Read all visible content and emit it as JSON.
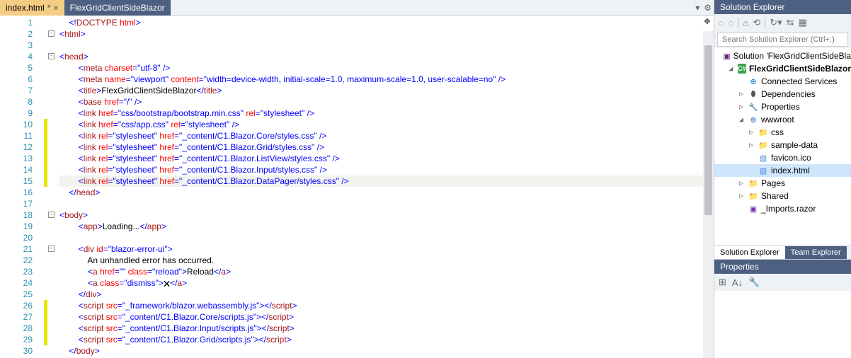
{
  "tabs": [
    {
      "label": "index.html",
      "dirty": "*",
      "active": true
    },
    {
      "label": "FlexGridClientSideBlazor",
      "dirty": "",
      "active": false
    }
  ],
  "code": {
    "lines": [
      {
        "n": 1,
        "ind": 1,
        "seg": [
          [
            "<!",
            "t-blue"
          ],
          [
            "DOCTYPE",
            "t-brown"
          ],
          [
            " ",
            "t-black"
          ],
          [
            "html",
            "t-red"
          ],
          [
            ">",
            "t-blue"
          ]
        ]
      },
      {
        "n": 2,
        "ind": 0,
        "box": "-",
        "seg": [
          [
            "<",
            "t-blue"
          ],
          [
            "html",
            "t-brown"
          ],
          [
            ">",
            "t-blue"
          ]
        ]
      },
      {
        "n": 3,
        "ind": 0,
        "seg": []
      },
      {
        "n": 4,
        "ind": 0,
        "box": "-",
        "seg": [
          [
            "<",
            "t-blue"
          ],
          [
            "head",
            "t-brown"
          ],
          [
            ">",
            "t-blue"
          ]
        ]
      },
      {
        "n": 5,
        "ind": 2,
        "seg": [
          [
            "<",
            "t-blue"
          ],
          [
            "meta",
            "t-brown"
          ],
          [
            " ",
            "t-black"
          ],
          [
            "charset",
            "t-red"
          ],
          [
            "=",
            "t-blue"
          ],
          [
            "\"utf-8\"",
            "t-blue"
          ],
          [
            " />",
            "t-blue"
          ]
        ]
      },
      {
        "n": 6,
        "ind": 2,
        "seg": [
          [
            "<",
            "t-blue"
          ],
          [
            "meta",
            "t-brown"
          ],
          [
            " ",
            "t-black"
          ],
          [
            "name",
            "t-red"
          ],
          [
            "=",
            "t-blue"
          ],
          [
            "\"viewport\"",
            "t-blue"
          ],
          [
            " ",
            "t-black"
          ],
          [
            "content",
            "t-red"
          ],
          [
            "=",
            "t-blue"
          ],
          [
            "\"width=device-width, initial-scale=1.0, maximum-scale=1.0, user-scalable=no\"",
            "t-blue"
          ],
          [
            " />",
            "t-blue"
          ]
        ]
      },
      {
        "n": 7,
        "ind": 2,
        "seg": [
          [
            "<",
            "t-blue"
          ],
          [
            "title",
            "t-brown"
          ],
          [
            ">",
            "t-blue"
          ],
          [
            "FlexGridClientSideBlazor",
            "t-black"
          ],
          [
            "</",
            "t-blue"
          ],
          [
            "title",
            "t-brown"
          ],
          [
            ">",
            "t-blue"
          ]
        ]
      },
      {
        "n": 8,
        "ind": 2,
        "seg": [
          [
            "<",
            "t-blue"
          ],
          [
            "base",
            "t-brown"
          ],
          [
            " ",
            "t-black"
          ],
          [
            "href",
            "t-red"
          ],
          [
            "=",
            "t-blue"
          ],
          [
            "\"/\"",
            "t-blue"
          ],
          [
            " />",
            "t-blue"
          ]
        ]
      },
      {
        "n": 9,
        "ind": 2,
        "seg": [
          [
            "<",
            "t-blue"
          ],
          [
            "link",
            "t-brown"
          ],
          [
            " ",
            "t-black"
          ],
          [
            "href",
            "t-red"
          ],
          [
            "=",
            "t-blue"
          ],
          [
            "\"css/bootstrap/bootstrap.min.css\"",
            "t-blue"
          ],
          [
            " ",
            "t-black"
          ],
          [
            "rel",
            "t-red"
          ],
          [
            "=",
            "t-blue"
          ],
          [
            "\"stylesheet\"",
            "t-blue"
          ],
          [
            " />",
            "t-blue"
          ]
        ]
      },
      {
        "n": 10,
        "ind": 2,
        "mark": true,
        "seg": [
          [
            "<",
            "t-blue"
          ],
          [
            "link",
            "t-brown"
          ],
          [
            " ",
            "t-black"
          ],
          [
            "href",
            "t-red"
          ],
          [
            "=",
            "t-blue"
          ],
          [
            "\"css/app.css\"",
            "t-blue"
          ],
          [
            " ",
            "t-black"
          ],
          [
            "rel",
            "t-red"
          ],
          [
            "=",
            "t-blue"
          ],
          [
            "\"stylesheet\"",
            "t-blue"
          ],
          [
            " />",
            "t-blue"
          ]
        ]
      },
      {
        "n": 11,
        "ind": 2,
        "mark": true,
        "seg": [
          [
            "<",
            "t-blue"
          ],
          [
            "link",
            "t-brown"
          ],
          [
            " ",
            "t-black"
          ],
          [
            "rel",
            "t-red"
          ],
          [
            "=",
            "t-blue"
          ],
          [
            "\"stylesheet\"",
            "t-blue"
          ],
          [
            " ",
            "t-black"
          ],
          [
            "href",
            "t-red"
          ],
          [
            "=",
            "t-blue"
          ],
          [
            "\"_content/C1.Blazor.Core/styles.css\"",
            "t-blue"
          ],
          [
            " />",
            "t-blue"
          ]
        ]
      },
      {
        "n": 12,
        "ind": 2,
        "mark": true,
        "seg": [
          [
            "<",
            "t-blue"
          ],
          [
            "link",
            "t-brown"
          ],
          [
            " ",
            "t-black"
          ],
          [
            "rel",
            "t-red"
          ],
          [
            "=",
            "t-blue"
          ],
          [
            "\"stylesheet\"",
            "t-blue"
          ],
          [
            " ",
            "t-black"
          ],
          [
            "href",
            "t-red"
          ],
          [
            "=",
            "t-blue"
          ],
          [
            "\"_content/C1.Blazor.Grid/styles.css\"",
            "t-blue"
          ],
          [
            " />",
            "t-blue"
          ]
        ]
      },
      {
        "n": 13,
        "ind": 2,
        "mark": true,
        "seg": [
          [
            "<",
            "t-blue"
          ],
          [
            "link",
            "t-brown"
          ],
          [
            " ",
            "t-black"
          ],
          [
            "rel",
            "t-red"
          ],
          [
            "=",
            "t-blue"
          ],
          [
            "\"stylesheet\"",
            "t-blue"
          ],
          [
            " ",
            "t-black"
          ],
          [
            "href",
            "t-red"
          ],
          [
            "=",
            "t-blue"
          ],
          [
            "\"_content/C1.Blazor.ListView/styles.css\"",
            "t-blue"
          ],
          [
            " />",
            "t-blue"
          ]
        ]
      },
      {
        "n": 14,
        "ind": 2,
        "mark": true,
        "seg": [
          [
            "<",
            "t-blue"
          ],
          [
            "link",
            "t-brown"
          ],
          [
            " ",
            "t-black"
          ],
          [
            "rel",
            "t-red"
          ],
          [
            "=",
            "t-blue"
          ],
          [
            "\"stylesheet\"",
            "t-blue"
          ],
          [
            " ",
            "t-black"
          ],
          [
            "href",
            "t-red"
          ],
          [
            "=",
            "t-blue"
          ],
          [
            "\"_content/C1.Blazor.Input/styles.css\"",
            "t-blue"
          ],
          [
            " />",
            "t-blue"
          ]
        ]
      },
      {
        "n": 15,
        "ind": 2,
        "mark": true,
        "hl": true,
        "seg": [
          [
            "<",
            "t-blue"
          ],
          [
            "link",
            "t-brown"
          ],
          [
            " ",
            "t-black"
          ],
          [
            "rel",
            "t-red"
          ],
          [
            "=",
            "t-blue"
          ],
          [
            "\"stylesheet\"",
            "t-blue"
          ],
          [
            " ",
            "t-black"
          ],
          [
            "href",
            "t-red"
          ],
          [
            "=",
            "t-blue"
          ],
          [
            "\"_content/C1.Blazor.DataPager/styles.css\"",
            "t-blue"
          ],
          [
            " />",
            "t-blue"
          ]
        ]
      },
      {
        "n": 16,
        "ind": 1,
        "seg": [
          [
            "</",
            "t-blue"
          ],
          [
            "head",
            "t-brown"
          ],
          [
            ">",
            "t-blue"
          ]
        ]
      },
      {
        "n": 17,
        "ind": 0,
        "seg": []
      },
      {
        "n": 18,
        "ind": 0,
        "box": "-",
        "seg": [
          [
            "<",
            "t-blue"
          ],
          [
            "body",
            "t-brown"
          ],
          [
            ">",
            "t-blue"
          ]
        ]
      },
      {
        "n": 19,
        "ind": 2,
        "seg": [
          [
            "<",
            "t-blue"
          ],
          [
            "app",
            "t-brown"
          ],
          [
            ">",
            "t-blue"
          ],
          [
            "Loading...",
            "t-black"
          ],
          [
            "</",
            "t-blue"
          ],
          [
            "app",
            "t-brown"
          ],
          [
            ">",
            "t-blue"
          ]
        ]
      },
      {
        "n": 20,
        "ind": 0,
        "seg": []
      },
      {
        "n": 21,
        "ind": 2,
        "box": "-",
        "seg": [
          [
            "<",
            "t-blue"
          ],
          [
            "div",
            "t-brown"
          ],
          [
            " ",
            "t-black"
          ],
          [
            "id",
            "t-red"
          ],
          [
            "=",
            "t-blue"
          ],
          [
            "\"blazor-error-ui\"",
            "t-blue"
          ],
          [
            ">",
            "t-blue"
          ]
        ]
      },
      {
        "n": 22,
        "ind": 3,
        "seg": [
          [
            "An unhandled error has occurred.",
            "t-black"
          ]
        ]
      },
      {
        "n": 23,
        "ind": 3,
        "seg": [
          [
            "<",
            "t-blue"
          ],
          [
            "a",
            "t-brown"
          ],
          [
            " ",
            "t-black"
          ],
          [
            "href",
            "t-red"
          ],
          [
            "=",
            "t-blue"
          ],
          [
            "\"\"",
            "t-blue"
          ],
          [
            " ",
            "t-black"
          ],
          [
            "class",
            "t-red"
          ],
          [
            "=",
            "t-blue"
          ],
          [
            "\"reload\"",
            "t-blue"
          ],
          [
            ">",
            "t-blue"
          ],
          [
            "Reload",
            "t-black"
          ],
          [
            "</",
            "t-blue"
          ],
          [
            "a",
            "t-brown"
          ],
          [
            ">",
            "t-blue"
          ]
        ]
      },
      {
        "n": 24,
        "ind": 3,
        "seg": [
          [
            "<",
            "t-blue"
          ],
          [
            "a",
            "t-brown"
          ],
          [
            " ",
            "t-black"
          ],
          [
            "class",
            "t-red"
          ],
          [
            "=",
            "t-blue"
          ],
          [
            "\"dismiss\"",
            "t-blue"
          ],
          [
            ">",
            "t-blue"
          ],
          [
            "🗙",
            "t-black"
          ],
          [
            "</",
            "t-blue"
          ],
          [
            "a",
            "t-brown"
          ],
          [
            ">",
            "t-blue"
          ]
        ]
      },
      {
        "n": 25,
        "ind": 2,
        "seg": [
          [
            "</",
            "t-blue"
          ],
          [
            "div",
            "t-brown"
          ],
          [
            ">",
            "t-blue"
          ]
        ]
      },
      {
        "n": 26,
        "ind": 2,
        "mark": true,
        "seg": [
          [
            "<",
            "t-blue"
          ],
          [
            "script",
            "t-brown"
          ],
          [
            " ",
            "t-black"
          ],
          [
            "src",
            "t-red"
          ],
          [
            "=",
            "t-blue"
          ],
          [
            "\"_framework/blazor.webassembly.js\"",
            "t-blue"
          ],
          [
            "></",
            "t-blue"
          ],
          [
            "script",
            "t-brown"
          ],
          [
            ">",
            "t-blue"
          ]
        ]
      },
      {
        "n": 27,
        "ind": 2,
        "mark": true,
        "seg": [
          [
            "<",
            "t-blue"
          ],
          [
            "script",
            "t-brown"
          ],
          [
            " ",
            "t-black"
          ],
          [
            "src",
            "t-red"
          ],
          [
            "=",
            "t-blue"
          ],
          [
            "\"_content/C1.Blazor.Core/scripts.js\"",
            "t-blue"
          ],
          [
            "></",
            "t-blue"
          ],
          [
            "script",
            "t-brown"
          ],
          [
            ">",
            "t-blue"
          ]
        ]
      },
      {
        "n": 28,
        "ind": 2,
        "mark": true,
        "seg": [
          [
            "<",
            "t-blue"
          ],
          [
            "script",
            "t-brown"
          ],
          [
            " ",
            "t-black"
          ],
          [
            "src",
            "t-red"
          ],
          [
            "=",
            "t-blue"
          ],
          [
            "\"_content/C1.Blazor.Input/scripts.js\"",
            "t-blue"
          ],
          [
            "></",
            "t-blue"
          ],
          [
            "script",
            "t-brown"
          ],
          [
            ">",
            "t-blue"
          ]
        ]
      },
      {
        "n": 29,
        "ind": 2,
        "mark": true,
        "seg": [
          [
            "<",
            "t-blue"
          ],
          [
            "script",
            "t-brown"
          ],
          [
            " ",
            "t-black"
          ],
          [
            "src",
            "t-red"
          ],
          [
            "=",
            "t-blue"
          ],
          [
            "\"_content/C1.Blazor.Grid/scripts.js\"",
            "t-blue"
          ],
          [
            "></",
            "t-blue"
          ],
          [
            "script",
            "t-brown"
          ],
          [
            ">",
            "t-blue"
          ]
        ]
      },
      {
        "n": 30,
        "ind": 1,
        "seg": [
          [
            "</",
            "t-blue"
          ],
          [
            "body",
            "t-brown"
          ],
          [
            ">",
            "t-blue"
          ]
        ]
      }
    ]
  },
  "solutionExplorer": {
    "title": "Solution Explorer",
    "searchPlaceholder": "Search Solution Explorer (Ctrl+;)",
    "tree": [
      {
        "depth": 0,
        "tw": "",
        "ico": "sln",
        "glyph": "▣",
        "label": "Solution 'FlexGridClientSideBla"
      },
      {
        "depth": 1,
        "tw": "◢",
        "ico": "proj",
        "glyph": "C#",
        "label": "FlexGridClientSideBlazor",
        "bold": true
      },
      {
        "depth": 2,
        "tw": "",
        "ico": "conn",
        "glyph": "⊕",
        "label": "Connected Services"
      },
      {
        "depth": 2,
        "tw": "▷",
        "ico": "dep",
        "glyph": "⬮",
        "label": "Dependencies"
      },
      {
        "depth": 2,
        "tw": "▷",
        "ico": "wrench",
        "glyph": "🔧",
        "label": "Properties"
      },
      {
        "depth": 2,
        "tw": "◢",
        "ico": "globe",
        "glyph": "⊕",
        "label": "wwwroot"
      },
      {
        "depth": 3,
        "tw": "▷",
        "ico": "folder",
        "glyph": "📁",
        "label": "css"
      },
      {
        "depth": 3,
        "tw": "▷",
        "ico": "folder",
        "glyph": "📁",
        "label": "sample-data"
      },
      {
        "depth": 3,
        "tw": "",
        "ico": "file",
        "glyph": "▧",
        "label": "favicon.ico"
      },
      {
        "depth": 3,
        "tw": "",
        "ico": "file",
        "glyph": "▧",
        "label": "index.html",
        "sel": true
      },
      {
        "depth": 2,
        "tw": "▷",
        "ico": "folder",
        "glyph": "📁",
        "label": "Pages"
      },
      {
        "depth": 2,
        "tw": "▷",
        "ico": "folder",
        "glyph": "📁",
        "label": "Shared"
      },
      {
        "depth": 2,
        "tw": "",
        "ico": "razor",
        "glyph": "▣",
        "label": "_Imports.razor"
      }
    ],
    "bottomTabs": {
      "active": "Solution Explorer",
      "other": "Team Explorer"
    }
  },
  "properties": {
    "title": "Properties"
  }
}
